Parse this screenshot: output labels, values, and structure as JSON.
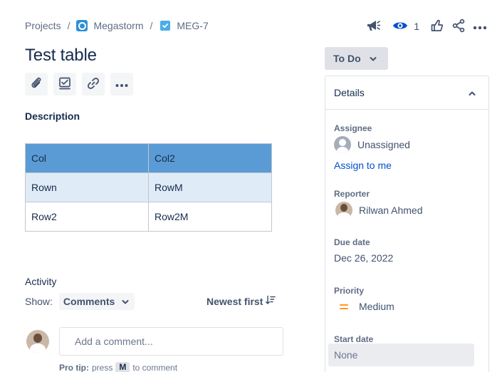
{
  "breadcrumb": {
    "projects": "Projects",
    "separator": "/",
    "project_name": "Megastorm",
    "issue_key": "MEG-7"
  },
  "top_actions": {
    "watch_count": "1",
    "icons": [
      "megaphone-icon",
      "eye-icon",
      "thumbs-up-icon",
      "share-icon",
      "more-icon"
    ]
  },
  "issue": {
    "title": "Test table"
  },
  "toolbar": {
    "icons": [
      "paperclip-icon",
      "checklist-icon",
      "link-icon",
      "more-icon"
    ]
  },
  "description": {
    "label": "Description",
    "table": {
      "rows": [
        [
          "Col",
          "Col2"
        ],
        [
          "Rown",
          "RowM"
        ],
        [
          "Row2",
          "Row2M"
        ]
      ]
    }
  },
  "activity": {
    "label": "Activity",
    "show_label": "Show:",
    "filter_value": "Comments",
    "sort_label": "Newest first",
    "comment_placeholder": "Add a comment...",
    "protip_prefix": "Pro tip:",
    "protip_press": "press",
    "protip_key": "M",
    "protip_suffix": "to comment"
  },
  "status": {
    "label": "To Do"
  },
  "details": {
    "header": "Details",
    "assignee_label": "Assignee",
    "assignee_value": "Unassigned",
    "assign_to_me": "Assign to me",
    "reporter_label": "Reporter",
    "reporter_value": "Rilwan Ahmed",
    "due_date_label": "Due date",
    "due_date_value": "Dec 26, 2022",
    "priority_label": "Priority",
    "priority_value": "Medium",
    "start_date_label": "Start date",
    "start_date_value": "None"
  },
  "colors": {
    "link": "#0052cc",
    "table_header": "#5a9bd5",
    "table_alt_row": "#dfebf6",
    "priority_medium": "#ff991f",
    "project_icon": "#2f8fd8",
    "task_icon": "#4bade8"
  }
}
